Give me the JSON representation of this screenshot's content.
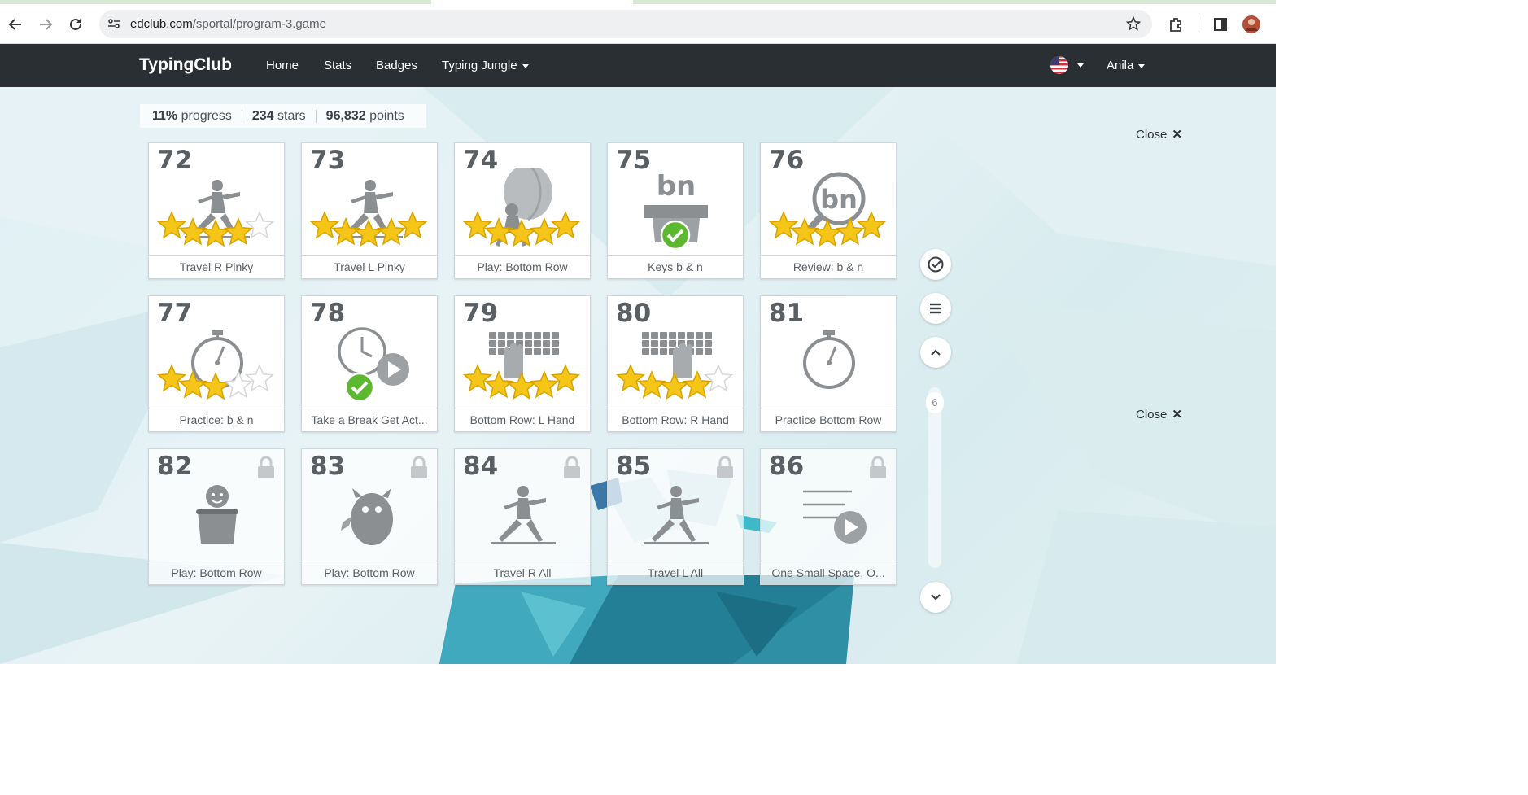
{
  "browser": {
    "url_host": "edclub.com",
    "url_path": "/sportal/program-3.game"
  },
  "site_nav": {
    "brand": "TypingClub",
    "links": [
      "Home",
      "Stats",
      "Badges",
      "Typing Jungle"
    ],
    "user": "Anila"
  },
  "stats": {
    "progress_value": "11%",
    "progress_label": "progress",
    "stars_value": "234",
    "stars_label": "stars",
    "points_value": "96,832",
    "points_label": "points"
  },
  "lessons": [
    {
      "num": "72",
      "label": "Travel R Pinky",
      "stars": 4,
      "icon": "yoga-pose-icon",
      "locked": false
    },
    {
      "num": "73",
      "label": "Travel L Pinky",
      "stars": 5,
      "icon": "yoga-pose-icon",
      "locked": false
    },
    {
      "num": "74",
      "label": "Play: Bottom Row",
      "stars": 5,
      "icon": "balloon-game-icon",
      "locked": false
    },
    {
      "num": "75",
      "label": "Keys b & n",
      "stars": 0,
      "icon": "new-keys-box-icon",
      "locked": false,
      "keys_text": "bn",
      "completed": true
    },
    {
      "num": "76",
      "label": "Review: b & n",
      "stars": 5,
      "icon": "magnifier-review-icon",
      "locked": false,
      "keys_text": "bn"
    },
    {
      "num": "77",
      "label": "Practice: b & n",
      "stars": 3,
      "icon": "stopwatch-icon",
      "locked": false
    },
    {
      "num": "78",
      "label": "Take a Break Get Act...",
      "stars": 0,
      "icon": "break-video-icon",
      "locked": false,
      "completed": true
    },
    {
      "num": "79",
      "label": "Bottom Row: L Hand",
      "stars": 5,
      "icon": "keyboard-left-hand-icon",
      "locked": false
    },
    {
      "num": "80",
      "label": "Bottom Row: R Hand",
      "stars": 4,
      "icon": "keyboard-right-hand-icon",
      "locked": false
    },
    {
      "num": "81",
      "label": "Practice Bottom Row",
      "stars": 0,
      "icon": "stopwatch-icon",
      "locked": false
    },
    {
      "num": "82",
      "label": "Play: Bottom Row",
      "stars": 0,
      "icon": "jar-character-icon",
      "locked": true
    },
    {
      "num": "83",
      "label": "Play: Bottom Row",
      "stars": 0,
      "icon": "monster-character-icon",
      "locked": true
    },
    {
      "num": "84",
      "label": "Travel R All",
      "stars": 0,
      "icon": "yoga-pose-icon",
      "locked": true
    },
    {
      "num": "85",
      "label": "Travel L All",
      "stars": 0,
      "icon": "yoga-pose-icon",
      "locked": true
    },
    {
      "num": "86",
      "label": "One Small Space, O...",
      "stars": 0,
      "icon": "text-video-icon",
      "locked": true
    }
  ],
  "side_controls": {
    "scroll_page": "6",
    "close_label": "Close",
    "close_symbol": "✕"
  },
  "colors": {
    "nav_bg": "#2a2f33",
    "star_gold": "#f5c518",
    "check_green": "#5cb82e",
    "icon_gray": "#8c8f91"
  }
}
